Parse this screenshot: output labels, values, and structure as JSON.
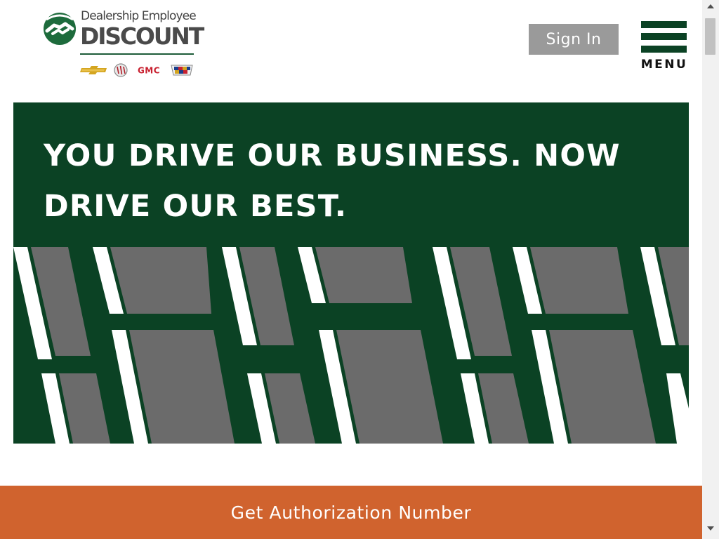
{
  "header": {
    "logo": {
      "line1": "Dealership Employee",
      "line2": "DISCOUNT",
      "mark_icon": "handshake-icon",
      "brands": [
        "Chevrolet",
        "Buick",
        "GMC",
        "Cadillac"
      ]
    },
    "signin_label": "Sign In",
    "menu_label": "MENU",
    "menu_icon": "hamburger-icon"
  },
  "hero": {
    "title_line1": "YOU DRIVE OUR BUSINESS. NOW",
    "title_line2": "DRIVE OUR BEST."
  },
  "cta": {
    "label": "Get Authorization Number"
  },
  "colors": {
    "brand_green": "#0b4224",
    "cta_orange": "#d0632e",
    "signin_gray": "#9a9a9a",
    "hero_tile_gray": "#6b6b6b"
  }
}
